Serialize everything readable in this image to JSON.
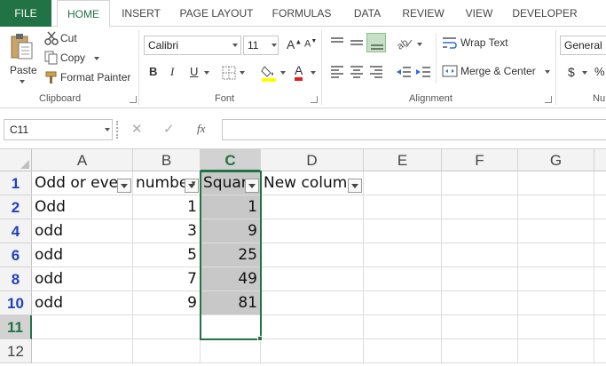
{
  "tabs": [
    "FILE",
    "HOME",
    "INSERT",
    "PAGE LAYOUT",
    "FORMULAS",
    "DATA",
    "REVIEW",
    "VIEW",
    "DEVELOPER"
  ],
  "clipboard": {
    "paste_label": "Paste",
    "cut_label": "Cut",
    "copy_label": "Copy",
    "format_painter_label": "Format Painter",
    "group_label": "Clipboard"
  },
  "font": {
    "family": "Calibri",
    "size": "11",
    "bold_label": "B",
    "italic_label": "I",
    "underline_label": "U",
    "font_color_label": "A",
    "group_label": "Font"
  },
  "alignment": {
    "wrap_text_label": "Wrap Text",
    "merge_center_label": "Merge & Center",
    "group_label": "Alignment"
  },
  "number": {
    "format": "General",
    "currency_label": "$",
    "percent_label": "%",
    "group_label": "Nu"
  },
  "formula_bar": {
    "name_box": "C11",
    "cancel_label": "✕",
    "enter_label": "✓",
    "fx_label": "fx",
    "formula": ""
  },
  "sheet": {
    "columns": [
      "A",
      "B",
      "C",
      "D",
      "E",
      "F",
      "G"
    ],
    "selected_column": "C",
    "rows": [
      {
        "num": "1",
        "cells": [
          "Odd or eve",
          "numbe",
          "Squar",
          "New colum",
          "",
          "",
          ""
        ]
      },
      {
        "num": "2",
        "cells": [
          "Odd",
          "1",
          "1",
          "",
          "",
          "",
          ""
        ]
      },
      {
        "num": "4",
        "cells": [
          "odd",
          "3",
          "9",
          "",
          "",
          "",
          ""
        ]
      },
      {
        "num": "6",
        "cells": [
          "odd",
          "5",
          "25",
          "",
          "",
          "",
          ""
        ]
      },
      {
        "num": "8",
        "cells": [
          "odd",
          "7",
          "49",
          "",
          "",
          "",
          ""
        ]
      },
      {
        "num": "10",
        "cells": [
          "odd",
          "9",
          "81",
          "",
          "",
          "",
          ""
        ]
      },
      {
        "num": "11",
        "cells": [
          "",
          "",
          "",
          "",
          "",
          "",
          ""
        ]
      },
      {
        "num": "12",
        "cells": [
          "",
          "",
          "",
          "",
          "",
          "",
          ""
        ]
      }
    ]
  },
  "colors": {
    "accent": "#217346",
    "filtered_row": "#1f3fc0",
    "selection_fill": "#c8c8c8"
  }
}
